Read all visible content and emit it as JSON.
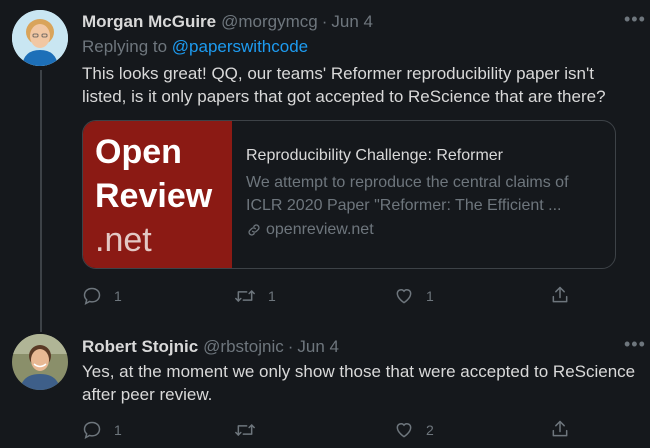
{
  "tweets": [
    {
      "name": "Morgan McGuire",
      "handle": "@morgymcg",
      "separator": "·",
      "date": "Jun 4",
      "replying_prefix": "Replying to",
      "replying_mention": "@paperswithcode",
      "body": "This looks great! QQ, our teams' Reformer reproducibility paper isn't listed, is it only papers that got accepted to ReScience that are there?",
      "card": {
        "logo_line1": "Open",
        "logo_line2": "Review",
        "logo_line3": ".net",
        "title": "Reproducibility Challenge: Reformer",
        "description": "We attempt to reproduce the central claims of ICLR 2020 Paper \"Reformer: The Efficient ...",
        "domain": "openreview.net"
      },
      "more": "•••",
      "stats": {
        "replies": "1",
        "retweets": "1",
        "likes": "1"
      }
    },
    {
      "name": "Robert Stojnic",
      "handle": "@rbstojnic",
      "separator": "·",
      "date": "Jun 4",
      "body": "Yes, at the moment we only show those that were accepted to ReScience after peer review.",
      "more": "•••",
      "stats": {
        "replies": "1",
        "retweets": "",
        "likes": "2"
      }
    }
  ],
  "colors": {
    "background": "#15181c",
    "text": "#d9d9d9",
    "muted": "#6e767d",
    "link": "#1d9bf0",
    "card_image": "#8b1a14"
  }
}
